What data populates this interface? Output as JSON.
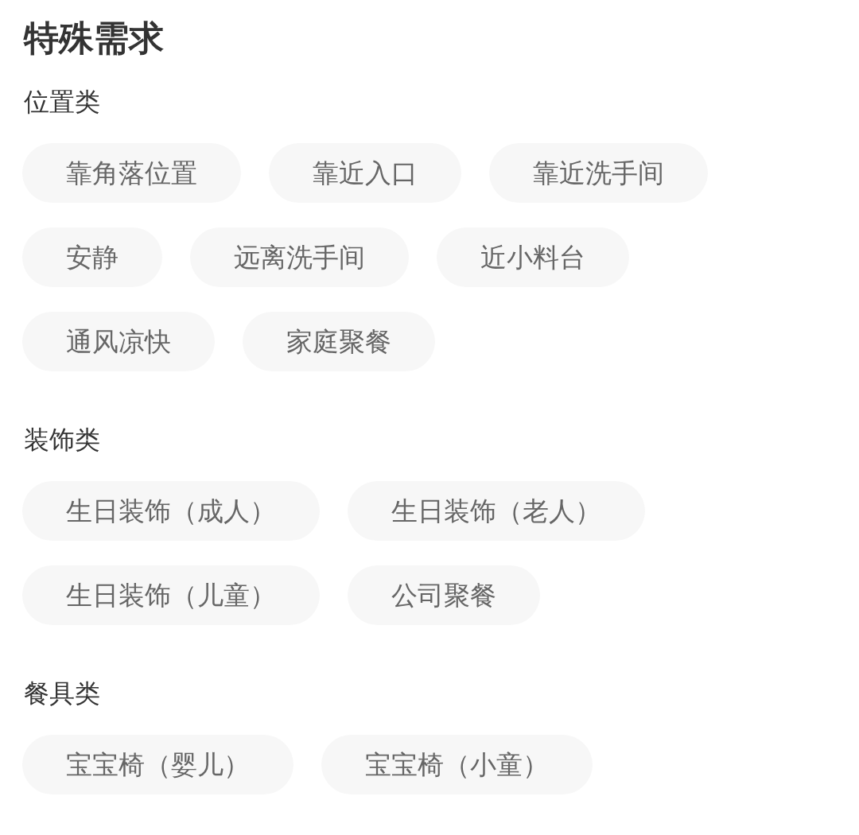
{
  "title": "特殊需求",
  "sections": [
    {
      "label": "位置类",
      "options": [
        {
          "label": "靠角落位置",
          "selected": false
        },
        {
          "label": "靠近入口",
          "selected": false
        },
        {
          "label": "靠近洗手间",
          "selected": false
        },
        {
          "label": "安静",
          "selected": false
        },
        {
          "label": "远离洗手间",
          "selected": false
        },
        {
          "label": "近小料台",
          "selected": false
        },
        {
          "label": "通风凉快",
          "selected": false
        },
        {
          "label": "家庭聚餐",
          "selected": false
        }
      ]
    },
    {
      "label": "装饰类",
      "options": [
        {
          "label": "生日装饰（成人）",
          "selected": false
        },
        {
          "label": "生日装饰（老人）",
          "selected": false
        },
        {
          "label": "生日装饰（儿童）",
          "selected": false
        },
        {
          "label": "公司聚餐",
          "selected": false
        }
      ]
    },
    {
      "label": "餐具类",
      "options": [
        {
          "label": "宝宝椅（婴儿）",
          "selected": false
        },
        {
          "label": "宝宝椅（小童）",
          "selected": false
        }
      ]
    }
  ]
}
